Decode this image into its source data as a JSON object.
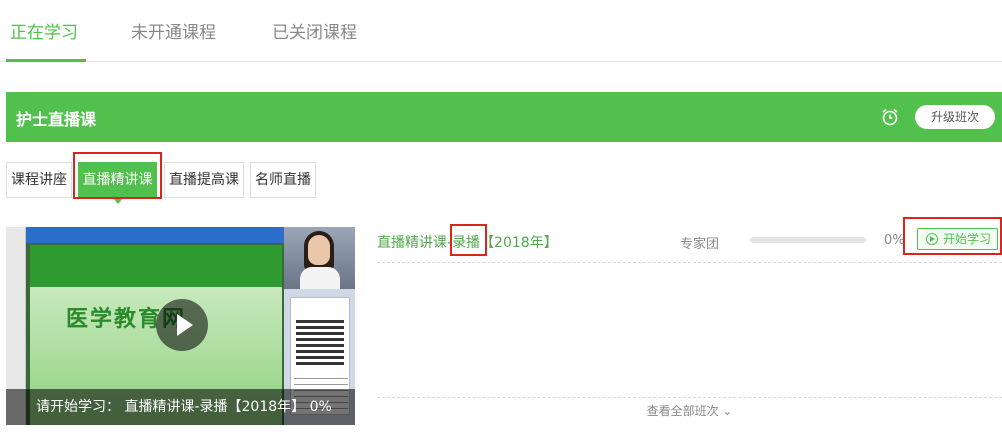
{
  "top_tabs": [
    {
      "label": "正在学习",
      "active": true
    },
    {
      "label": "未开通课程",
      "active": false
    },
    {
      "label": "已关闭课程",
      "active": false
    }
  ],
  "course": {
    "title": "护士直播课",
    "upgrade_label": "升级班次",
    "icons": {
      "alarm": "alarm-clock-icon"
    },
    "accent_color": "#52c04d"
  },
  "sub_tabs": [
    {
      "label": "课程讲座",
      "active": false
    },
    {
      "label": "直播精讲课",
      "active": true
    },
    {
      "label": "直播提高课",
      "active": false
    },
    {
      "label": "名师直播",
      "active": false
    }
  ],
  "video": {
    "caption": "请开始学习： 直播精讲课-录播【2018年】 0%",
    "slide_text": "医学教育网"
  },
  "class_item": {
    "name_prefix": "直播精讲课-",
    "name_highlight": "录播",
    "name_suffix": "【2018年】",
    "teacher": "专家团",
    "progress": 0,
    "percent_label": "0%",
    "start_label": "开始学习"
  },
  "view_all_label": "查看全部班次 ⌄"
}
